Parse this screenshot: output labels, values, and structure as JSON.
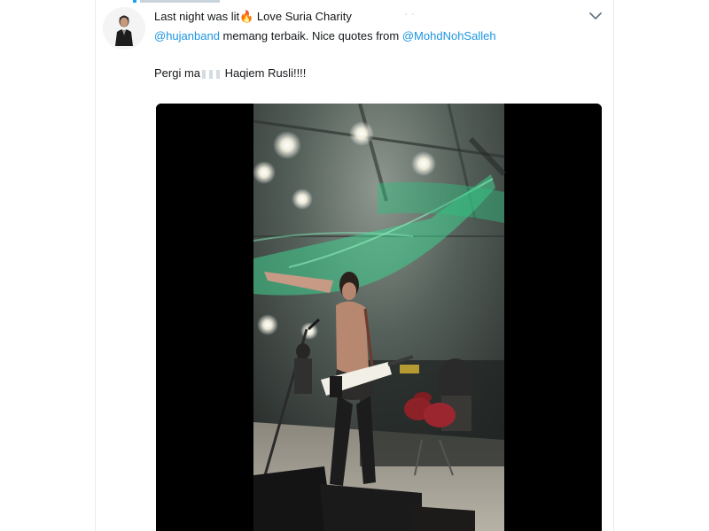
{
  "tweet": {
    "line1_text": "Last night was lit",
    "line1_emoji": "🔥",
    "line1_rest": " Love Suria Charity",
    "mention1": "@hujanband",
    "line2_text": " memang terbaik. Nice quotes from ",
    "mention2": "@MohdNohSalleh",
    "line3_start": "Pergi ma",
    "line3_end": "Haqiem Rusli!!!!"
  },
  "icons": {
    "avatar": "avatar",
    "caret": "chevron-down-icon"
  },
  "colors": {
    "link": "#1b95e0",
    "text": "#14171a",
    "video_bg": "#000000",
    "stage_green": "#2ecc8a"
  }
}
